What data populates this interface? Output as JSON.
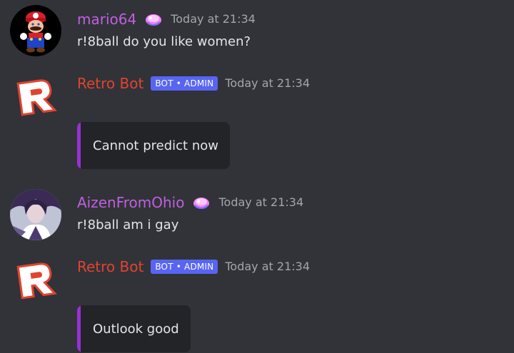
{
  "messages": [
    {
      "username": "mario64",
      "timestamp": "Today at 21:34",
      "text": "r!8ball do you like women?",
      "badge_icon": "nitro-gem-icon"
    },
    {
      "username": "Retro Bot",
      "tag": "BOT • ADMIN",
      "timestamp": "Today at 21:34",
      "embed_text": "Cannot predict now"
    },
    {
      "username": "AizenFromOhio",
      "timestamp": "Today at 21:34",
      "text": "r!8ball am i gay",
      "badge_icon": "nitro-gem-icon"
    },
    {
      "username": "Retro Bot",
      "tag": "BOT • ADMIN",
      "timestamp": "Today at 21:34",
      "embed_text": "Outlook good"
    }
  ],
  "colors": {
    "background": "#313338",
    "user_name_purple": "#c15fe0",
    "bot_name_red": "#e2432f",
    "bot_tag": "#5865f2",
    "embed_bar": "#9b2fd6",
    "embed_bg": "#232428"
  }
}
